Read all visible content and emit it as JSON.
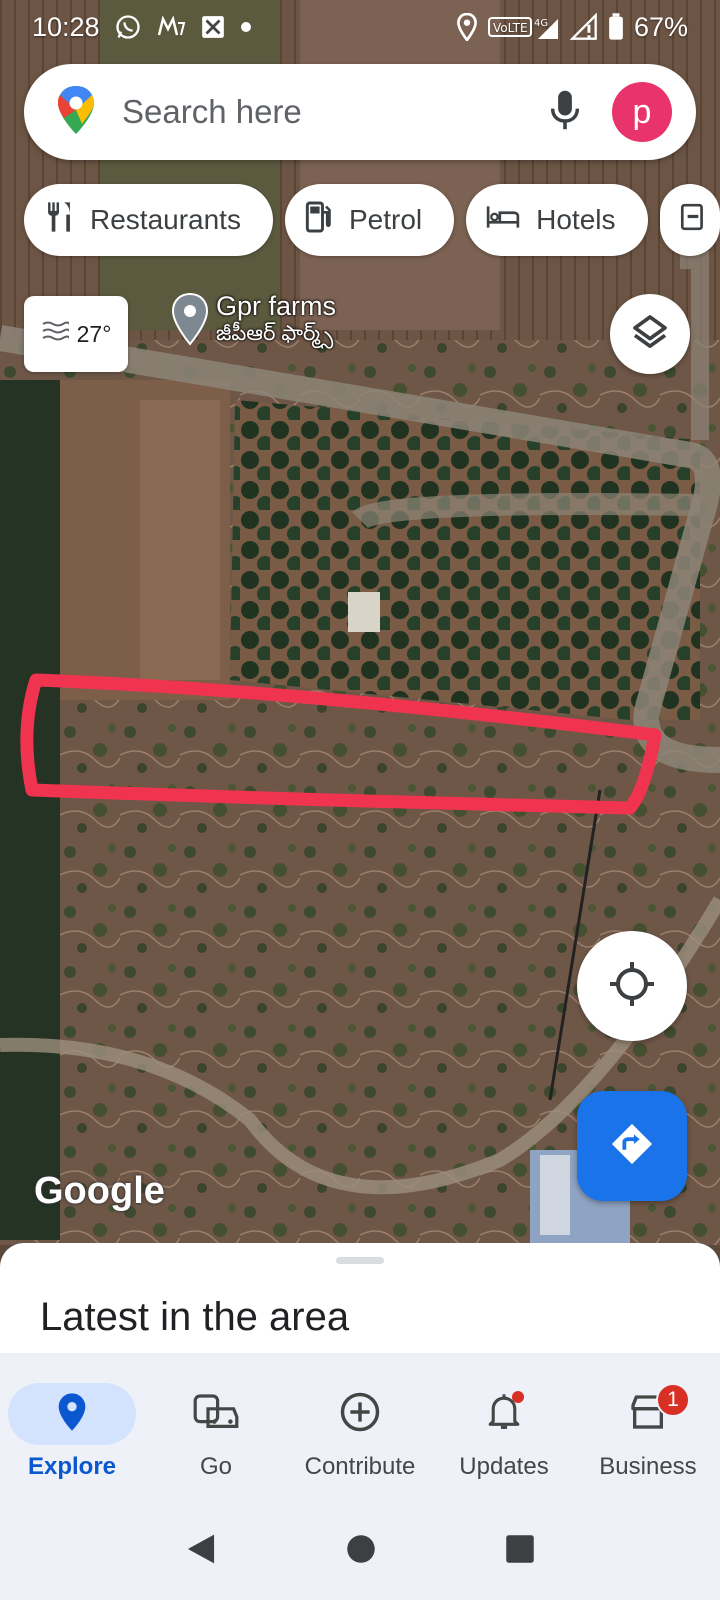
{
  "status_bar": {
    "time": "10:28",
    "battery": "67%",
    "network": "VoLTE 4G",
    "left_icons": [
      "whatsapp-icon",
      "myntra-icon",
      "app-icon",
      "dot-icon"
    ],
    "right_icons": [
      "location-icon",
      "volte-icon",
      "signal-icon",
      "signal-alert-icon",
      "battery-icon"
    ]
  },
  "search": {
    "placeholder": "Search here",
    "avatar_letter": "p"
  },
  "chips": [
    {
      "label": "Restaurants",
      "icon": "restaurant-icon"
    },
    {
      "label": "Petrol",
      "icon": "fuel-icon"
    },
    {
      "label": "Hotels",
      "icon": "hotel-icon"
    }
  ],
  "weather": {
    "temperature": "27°",
    "icon": "haze-icon"
  },
  "place": {
    "name": "Gpr farms",
    "name_local": "జీపీఆర్ ఫార్మ్స్"
  },
  "map_logo": "Google",
  "sheet": {
    "title": "Latest in the area"
  },
  "bottom_nav": [
    {
      "label": "Explore",
      "icon": "explore-pin-icon",
      "active": true
    },
    {
      "label": "Go",
      "icon": "commute-icon",
      "active": false
    },
    {
      "label": "Contribute",
      "icon": "add-circle-icon",
      "active": false
    },
    {
      "label": "Updates",
      "icon": "bell-icon",
      "active": false,
      "dot": true
    },
    {
      "label": "Business",
      "icon": "storefront-icon",
      "active": false,
      "badge": "1"
    }
  ],
  "colors": {
    "accent": "#1a73e8",
    "avatar": "#e8336d",
    "annotation": "#f0344f",
    "nav_active": "#0b57d0"
  }
}
